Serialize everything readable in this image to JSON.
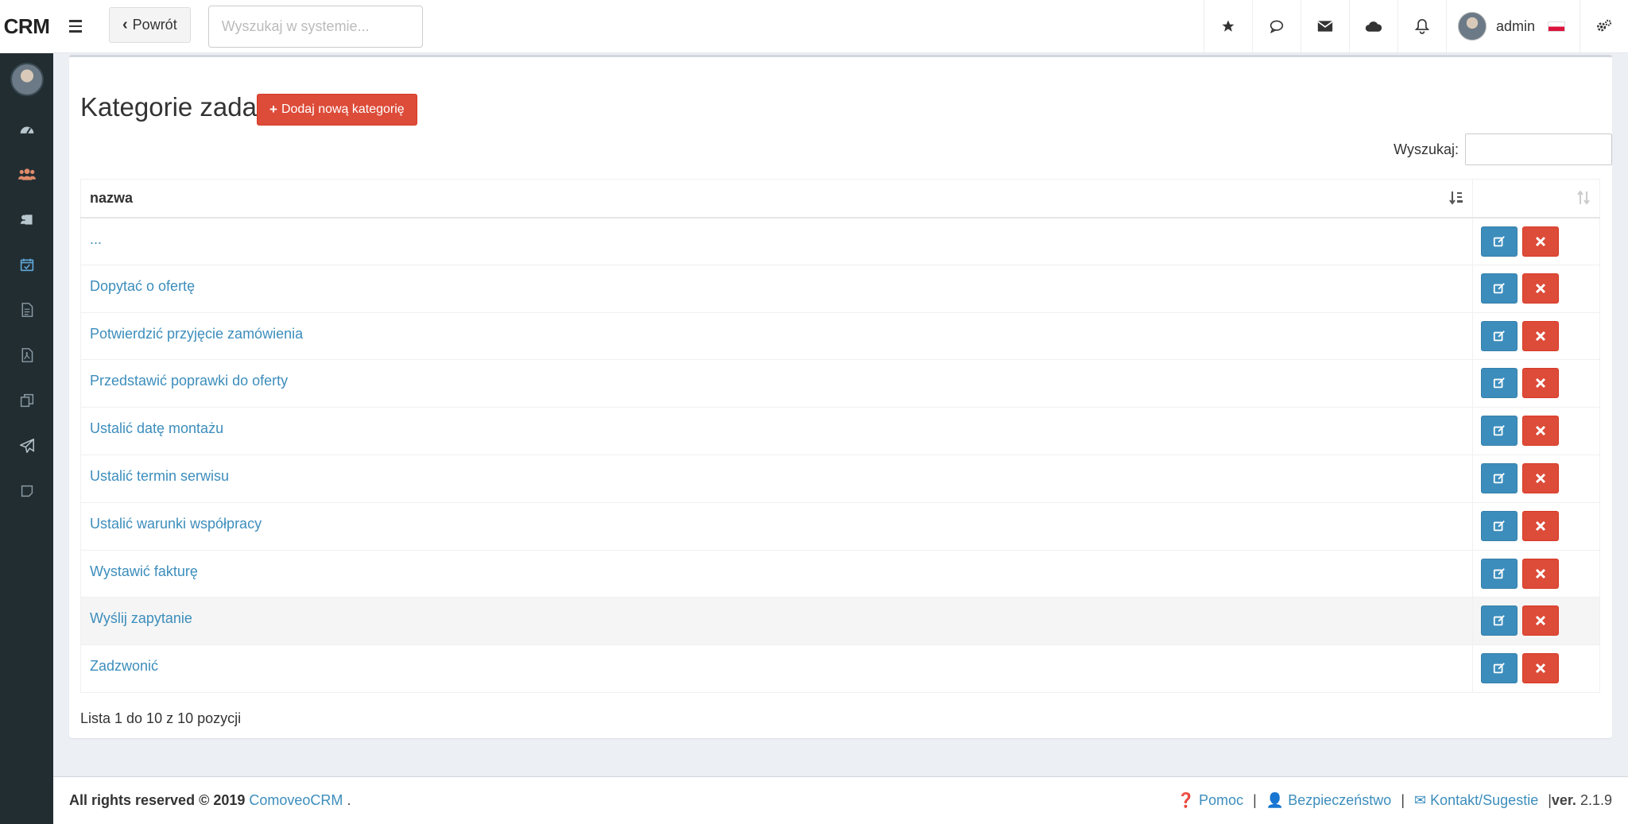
{
  "brand": "CRM",
  "topbar": {
    "back_label": "Powrót",
    "search_placeholder": "Wyszukaj w systemie...",
    "user_name": "admin"
  },
  "page": {
    "title": "Kategorie zadań",
    "add_button": "Dodaj nową kategorię",
    "filter_label": "Wyszukaj:"
  },
  "table": {
    "column_name": "nazwa",
    "rows": [
      "...",
      "Dopytać o ofertę",
      "Potwierdzić przyjęcie zamówienia",
      "Przedstawić poprawki do oferty",
      "Ustalić datę montażu",
      "Ustalić termin serwisu",
      "Ustalić warunki współpracy",
      "Wystawić fakturę",
      "Wyślij zapytanie",
      "Zadzwonić"
    ],
    "info": "Lista 1 do 10 z 10 pozycji"
  },
  "footer": {
    "rights": "All rights reserved © 2019",
    "company": "ComoveoCRM",
    "dot": ".",
    "help": "Pomoc",
    "security": "Bezpieczeństwo",
    "contact": "Kontakt/Sugestie",
    "ver_label": "ver.",
    "ver_value": "2.1.9"
  },
  "colors": {
    "sidebar": "#222d32",
    "link": "#3c8dbc",
    "danger": "#dd4b39",
    "primary": "#3c8dbc"
  },
  "icons": {
    "sidebar": [
      "dashboard-icon",
      "users-icon",
      "contacts-icon",
      "calendar-check-icon",
      "document-icon",
      "pdf-icon",
      "copy-icon",
      "send-icon",
      "note-icon"
    ],
    "topbar": [
      "star-icon",
      "chat-icon",
      "envelope-icon",
      "cloud-icon",
      "bell-icon",
      "settings-icon"
    ]
  }
}
